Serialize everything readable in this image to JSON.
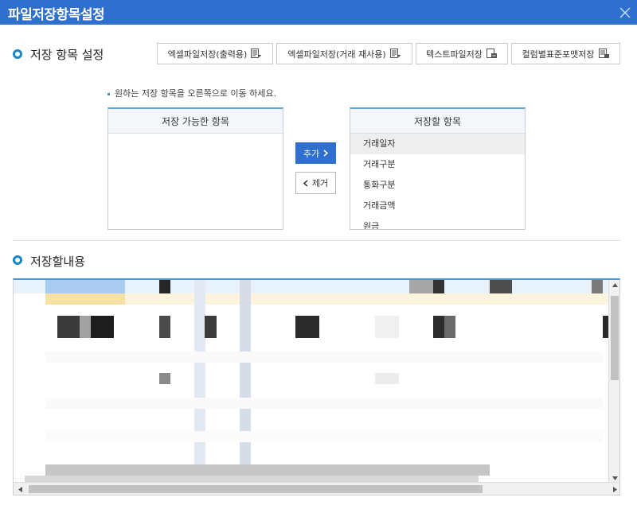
{
  "window": {
    "title": "파일저장항목설정"
  },
  "settings_section": {
    "title": "저장 항목 설정"
  },
  "toolbar": {
    "excel_print_label": "엑셀파일저장(출력용)",
    "excel_reuse_label": "엑셀파일저장(거래 재사용)",
    "text_save_label": "텍스트파일저장",
    "column_format_label": "컬럼별표준포맷저장"
  },
  "guide_text": "원하는 저장 항목을 오른쪽으로 이동 하세요.",
  "available_list": {
    "header": "저장 가능한 항목",
    "items": []
  },
  "selected_list": {
    "header": "저장할 항목",
    "items": [
      "거래일자",
      "거래구분",
      "통화구분",
      "거래금액",
      "원금"
    ]
  },
  "buttons": {
    "add_label": "추가",
    "remove_label": "제거"
  },
  "content_section": {
    "title": "저장할내용"
  },
  "colors": {
    "accent": "#2f6fcf",
    "header_line": "#3e9adf",
    "icon": "#1a85c7"
  }
}
